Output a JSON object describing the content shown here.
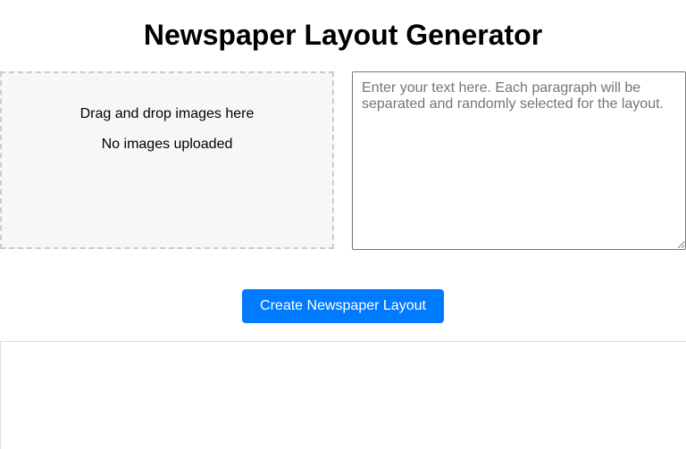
{
  "header": {
    "title": "Newspaper Layout Generator"
  },
  "image_drop": {
    "prompt": "Drag and drop images here",
    "status": "No images uploaded"
  },
  "text_input": {
    "value": "",
    "placeholder": "Enter your text here. Each paragraph will be separated and randomly selected for the layout."
  },
  "actions": {
    "create_label": "Create Newspaper Layout"
  },
  "colors": {
    "accent": "#007bff",
    "drop_zone_bg": "#f7f7f7",
    "drop_zone_border": "#cccccc"
  }
}
